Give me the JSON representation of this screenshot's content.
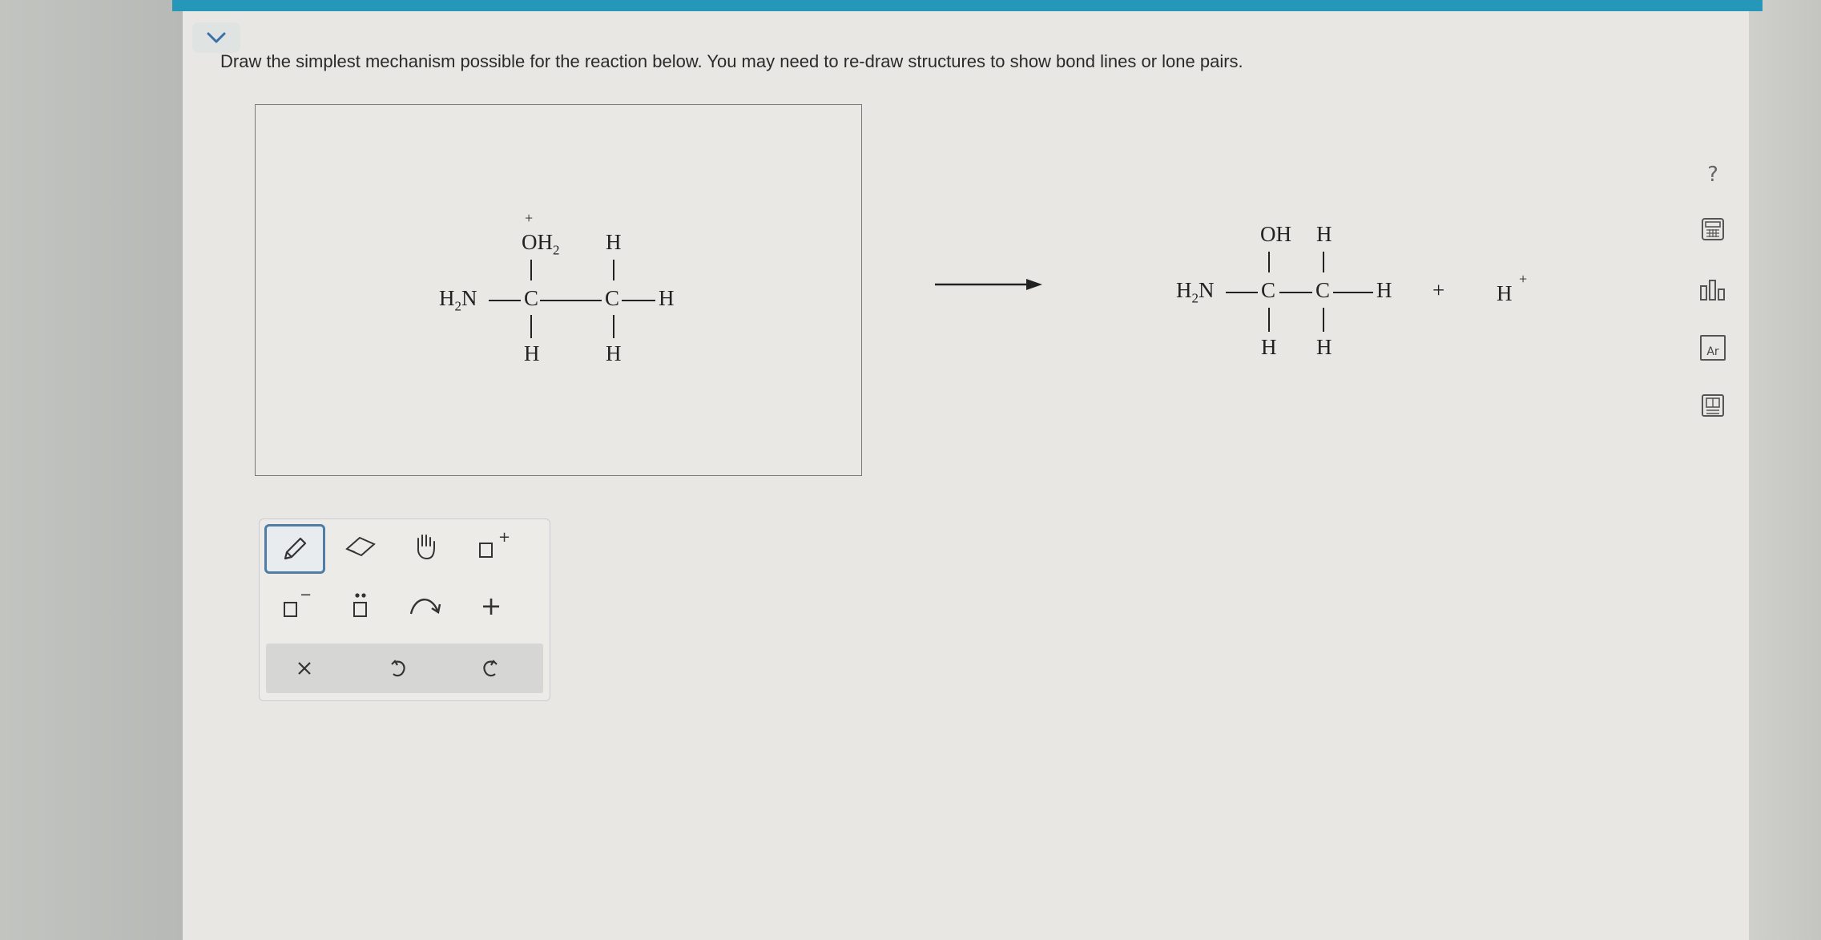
{
  "question": {
    "text": "Draw the simplest mechanism possible for the reaction below. You may need to re-draw structures to show bond lines or lone pairs."
  },
  "reactant": {
    "oxonium_charge": "+",
    "oxonium": "OH",
    "oxonium_sub": "2",
    "amine": "H",
    "amine_sub": "2",
    "amine_n": "N",
    "carbon1": "C",
    "carbon2": "C",
    "h_top": "H",
    "h_right": "H",
    "h_bottom1": "H",
    "h_bottom2": "H"
  },
  "product": {
    "oh": "OH",
    "h_top": "H",
    "amine": "H",
    "amine_sub": "2",
    "amine_n": "N",
    "carbon1": "C",
    "carbon2": "C",
    "h_right": "H",
    "h_bottom1": "H",
    "h_bottom2": "H",
    "plus": "+",
    "proton": "H",
    "proton_charge": "+"
  },
  "toolbar": {
    "add_charge_plus": "+",
    "add_charge_minus": "−",
    "add_plus": "+"
  },
  "side_tools": {
    "help_label": "?",
    "periodic_label": "Ar"
  },
  "colors": {
    "accent": "#2597b8",
    "active_tool_border": "#4f7da6"
  }
}
